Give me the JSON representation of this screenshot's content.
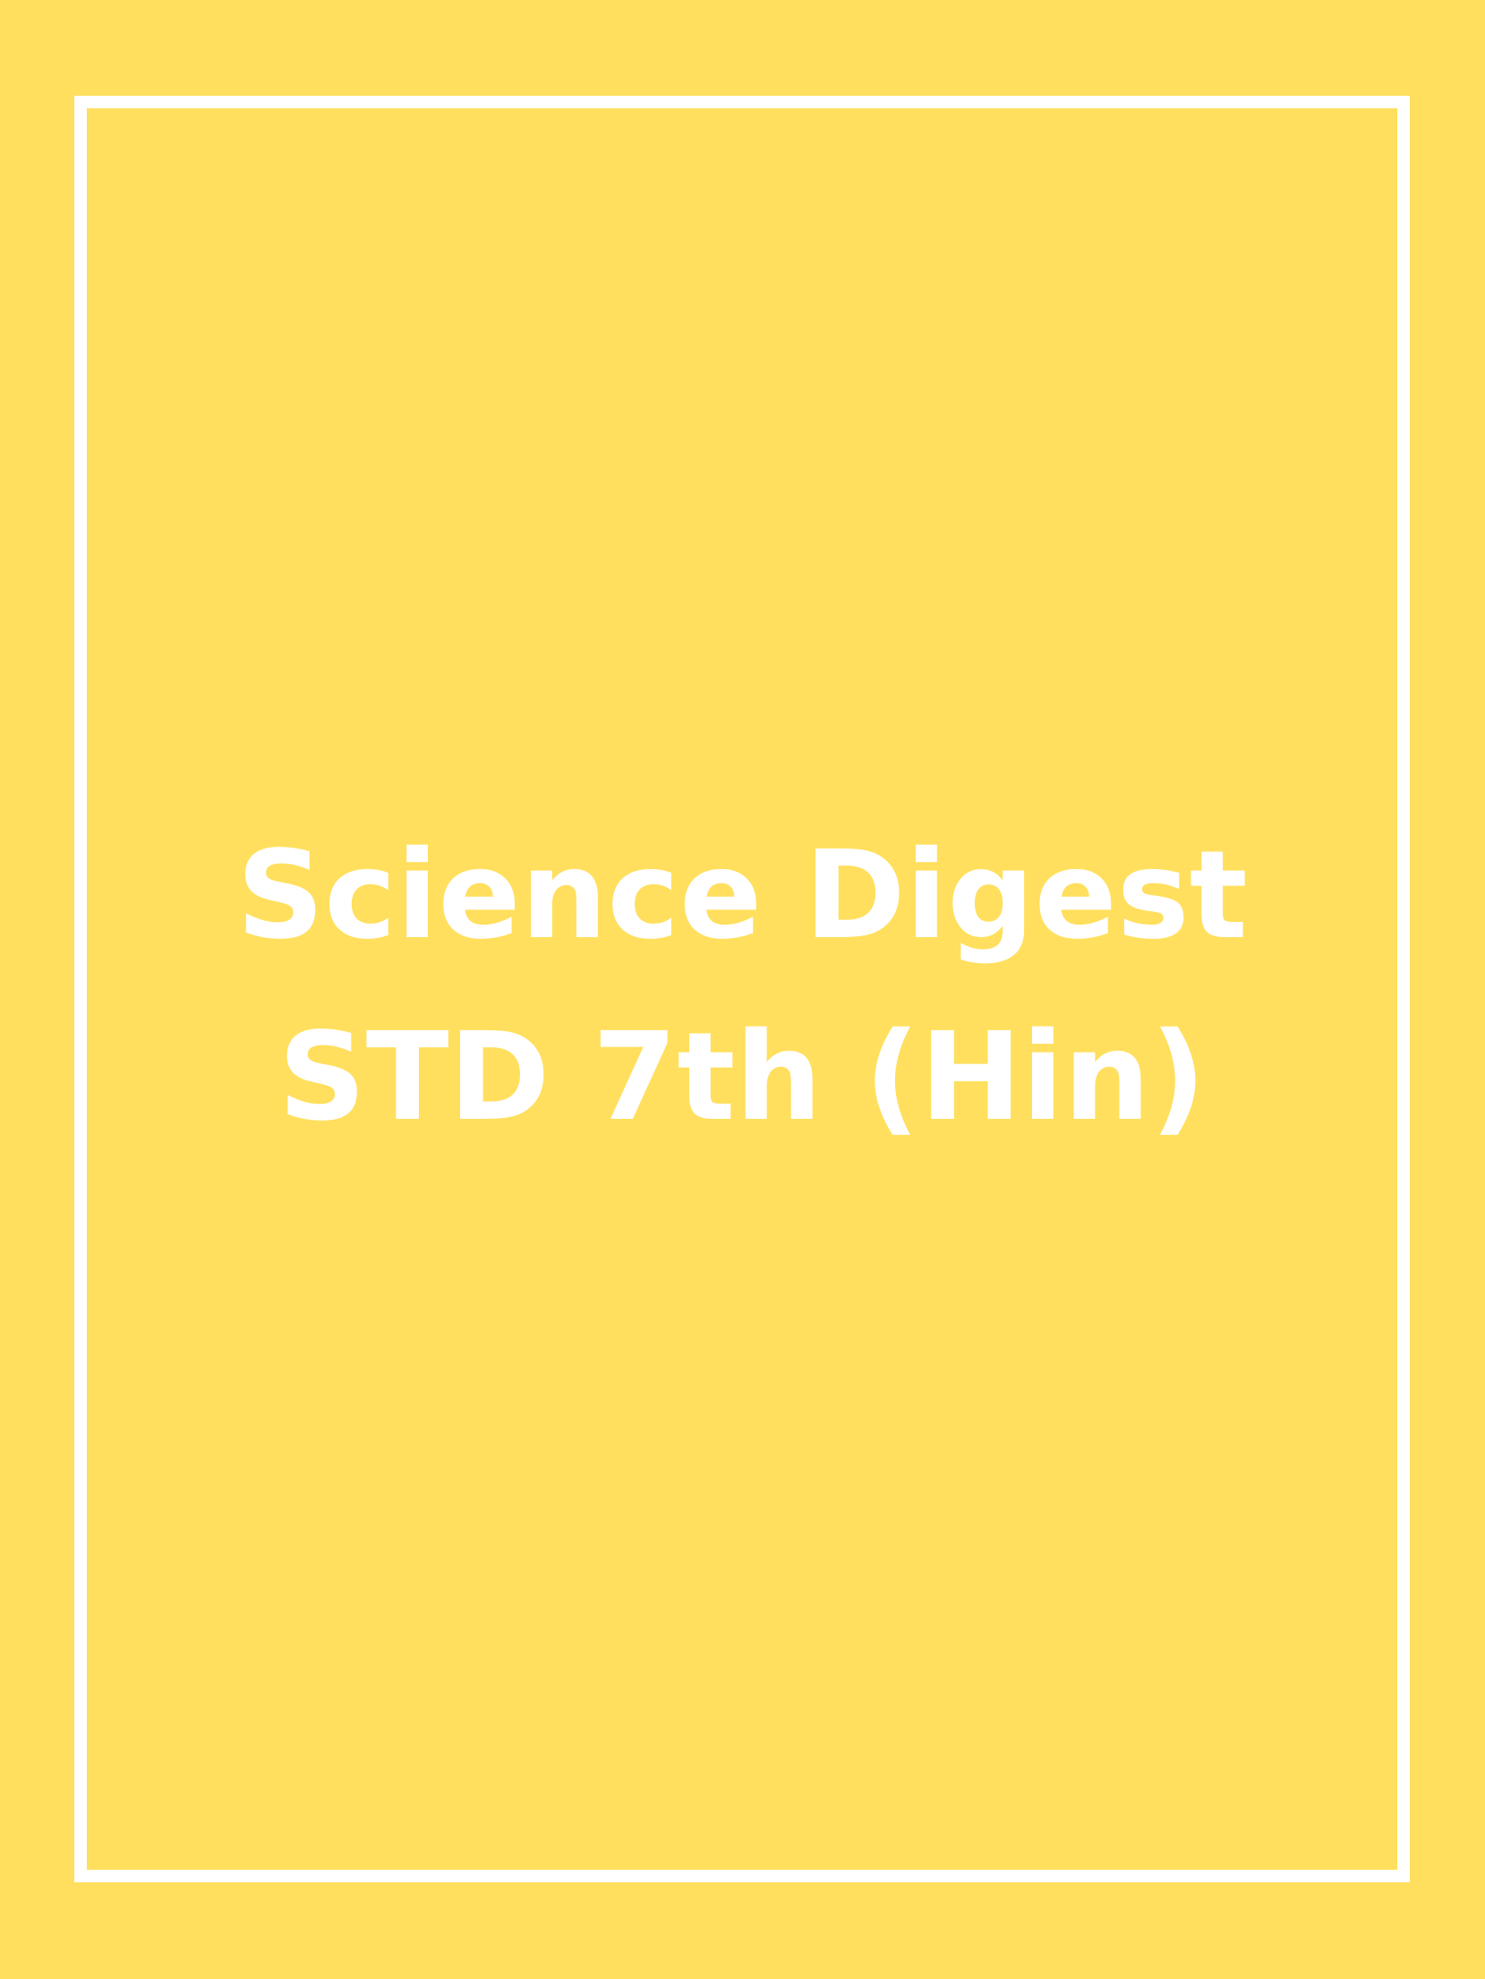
{
  "cover": {
    "title_line_1": "Science Digest",
    "title_line_2": "STD 7th (Hin)"
  },
  "colors": {
    "background": "#FFDF5D",
    "frame": "#FFFFFF",
    "text": "#FFFFFF"
  }
}
